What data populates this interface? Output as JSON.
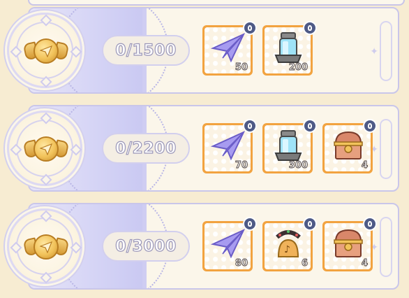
{
  "milestones": [
    {
      "progress": "0/1500",
      "rewards": [
        {
          "icon": "paper-plane-icon",
          "qty": "50"
        },
        {
          "icon": "energy-canister-icon",
          "qty": "200"
        }
      ]
    },
    {
      "progress": "0/2200",
      "rewards": [
        {
          "icon": "paper-plane-icon",
          "qty": "70"
        },
        {
          "icon": "energy-canister-icon",
          "qty": "300"
        },
        {
          "icon": "treasure-chest-icon",
          "qty": "4"
        }
      ]
    },
    {
      "progress": "0/3000",
      "rewards": [
        {
          "icon": "paper-plane-icon",
          "qty": "80"
        },
        {
          "icon": "music-bell-icon",
          "qty": "6"
        },
        {
          "icon": "treasure-chest-icon",
          "qty": "4"
        }
      ]
    }
  ],
  "colors": {
    "background": "#f7ecd2",
    "card": "#fbf6ea",
    "left_panel": "#d4d3f5",
    "item_frame": "#f2a340",
    "info_badge": "#4e5a86",
    "coin_gold": "#f2c35b"
  }
}
